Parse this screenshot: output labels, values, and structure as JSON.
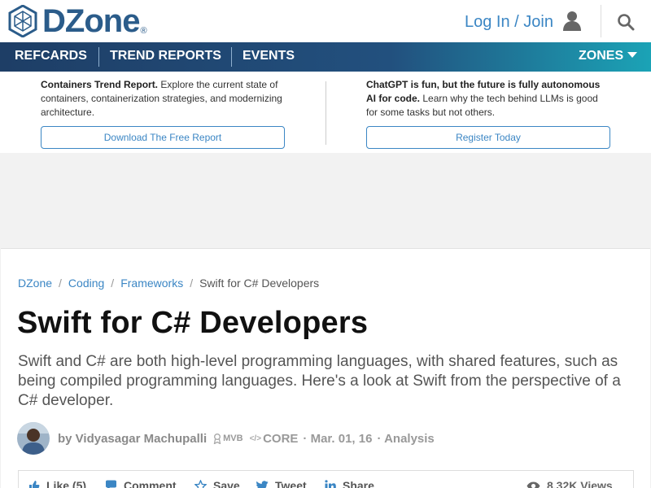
{
  "header": {
    "logo_text": "DZone",
    "logo_reg": "®",
    "login_label": "Log In / Join",
    "user_icon": "user-icon",
    "search_icon": "search-icon"
  },
  "nav": {
    "items": [
      {
        "label": "REFCARDS"
      },
      {
        "label": "TREND REPORTS"
      },
      {
        "label": "EVENTS"
      }
    ],
    "zones_label": "ZONES"
  },
  "promo": {
    "left": {
      "bold": "Containers Trend Report.",
      "text": " Explore the current state of containers, containerization strategies, and modernizing architecture.",
      "button": "Download The Free Report"
    },
    "right": {
      "bold": "ChatGPT is fun, but the future is fully autonomous AI for code.",
      "text": " Learn why the tech behind LLMs is good for some tasks but not others.",
      "button": "Register Today"
    }
  },
  "breadcrumb": {
    "items": [
      "DZone",
      "Coding",
      "Frameworks"
    ],
    "current": "Swift for C# Developers"
  },
  "article": {
    "title": "Swift for C# Developers",
    "description": "Swift and C# are both high-level programming languages, with shared features, such as being compiled programming languages. Here's a look at Swift from the perspective of a C# developer.",
    "author": "by Vidyasagar Machupalli",
    "badge": "MVB",
    "core": "CORE",
    "date": "· Mar. 01, 16",
    "category": "· Analysis"
  },
  "actions": {
    "like": "Like (5)",
    "comment": "Comment",
    "save": "Save",
    "tweet": "Tweet",
    "share": "Share",
    "views": "8.32K Views"
  },
  "colors": {
    "brand_blue": "#2b5c8a",
    "link_blue": "#3b86c4",
    "nav_gradient_start": "#1e3e66",
    "nav_gradient_end": "#1ba3b6"
  }
}
